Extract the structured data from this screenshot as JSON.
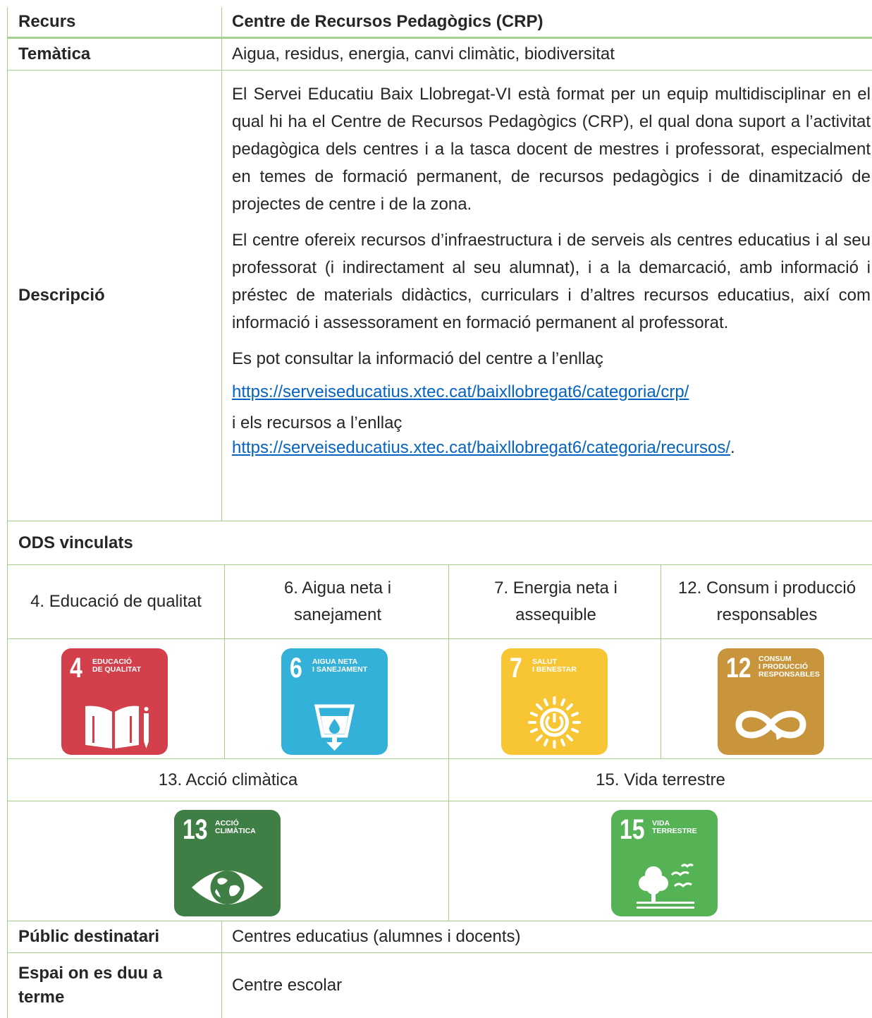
{
  "header": {
    "label": "Recurs",
    "value": "Centre de Recursos Pedagògics (CRP)"
  },
  "tematica": {
    "label": "Temàtica",
    "value": "Aigua, residus, energia, canvi climàtic, biodiversitat"
  },
  "descripcio": {
    "label": "Descripció",
    "paragraph1": "El Servei Educatiu Baix Llobregat-VI està format per un equip multidisciplinar en el qual hi ha el Centre de Recursos Pedagògics (CRP), el qual dona suport a l’activitat pedagògica dels centres i a la tasca docent de mestres i professorat, especialment en temes de formació permanent, de recursos pedagògics i de dinamització de projectes de centre i de la zona.",
    "paragraph2": "El centre ofereix recursos d’infraestructura i de serveis als centres educatius i al seu professorat (i indirectament al seu alumnat), i a la demarcació, amb informació i préstec de materials didàctics, curriculars i d’altres recursos educatius, així com informació i assessorament en formació permanent al professorat.",
    "paragraph3": "Es pot consultar la informació del centre a l’enllaç",
    "link1": "https://serveiseducatius.xtec.cat/baixllobregat6/categoria/crp/",
    "paragraph4": "i els recursos a l’enllaç",
    "link2": "https://serveiseducatius.xtec.cat/baixllobregat6/categoria/recursos/",
    "link2_suffix": "."
  },
  "ods": {
    "label": "ODS vinculats",
    "row1": [
      "4. Educació de qualitat",
      "6. Aigua neta i sanejament",
      "7. Energia neta i assequible",
      "12. Consum i producció responsables"
    ],
    "row2": [
      "13. Acció climàtica",
      "15. Vida terrestre"
    ],
    "icons": [
      {
        "number": "4",
        "caption1": "EDUCACIÓ",
        "caption2": "DE QUALITAT",
        "color": "#d3404b",
        "icon": "book-pencil-icon"
      },
      {
        "number": "6",
        "caption1": "AIGUA NETA",
        "caption2": "I SANEJAMENT",
        "color": "#34b1d9",
        "icon": "water-drop-icon"
      },
      {
        "number": "7",
        "caption1": "SALUT",
        "caption2": "I BENESTAR",
        "color": "#f8c634",
        "icon": "sun-power-icon"
      },
      {
        "number": "12",
        "caption1": "CONSUM",
        "caption2": "I PRODUCCIÓ",
        "caption3": "RESPONSABLES",
        "color": "#c8953c",
        "icon": "infinity-icon"
      },
      {
        "number": "13",
        "caption1": "ACCIÓ",
        "caption2": "CLIMÀTICA",
        "color": "#3f7e44",
        "icon": "eye-globe-icon"
      },
      {
        "number": "15",
        "caption1": "VIDA",
        "caption2": "TERRESTRE",
        "color": "#56b355",
        "icon": "tree-birds-icon"
      }
    ]
  },
  "public": {
    "label": "Públic destinatari",
    "value": "Centres educatius (alumnes i docents)"
  },
  "espai": {
    "label": "Espai on es duu a terme",
    "value": "Centre escolar"
  }
}
